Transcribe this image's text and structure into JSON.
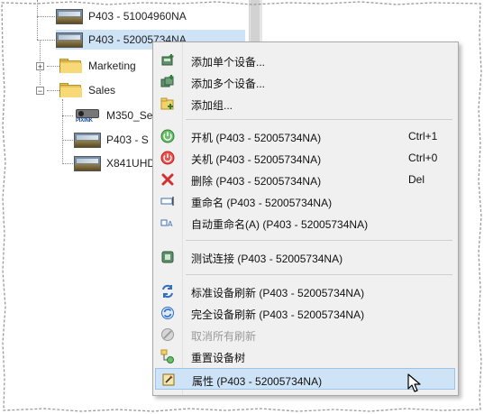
{
  "tree": {
    "items": [
      {
        "label": "P403 - 51004960NA",
        "type": "device"
      },
      {
        "label": "P403 - 52005734NA",
        "type": "device",
        "selected": true
      },
      {
        "label": "Marketing",
        "type": "folder",
        "expander": "+"
      },
      {
        "label": "Sales",
        "type": "folder",
        "expander": "−"
      },
      {
        "label": "M350_Se",
        "type": "projector"
      },
      {
        "label": "P403 - S",
        "type": "device"
      },
      {
        "label": "X841UHD",
        "type": "device"
      }
    ],
    "brand_text": "PIXINK"
  },
  "menu": {
    "items": [
      {
        "label": "添加单个设备...",
        "icon": "add-device-icon",
        "shortcut": ""
      },
      {
        "label": "添加多个设备...",
        "icon": "add-devices-icon",
        "shortcut": ""
      },
      {
        "label": "添加组...",
        "icon": "add-group-icon",
        "shortcut": ""
      },
      {
        "label": "开机  (P403 - 52005734NA)",
        "icon": "power-on-icon",
        "shortcut": "Ctrl+1"
      },
      {
        "label": "关机  (P403 - 52005734NA)",
        "icon": "power-off-icon",
        "shortcut": "Ctrl+0"
      },
      {
        "label": "删除  (P403 - 52005734NA)",
        "icon": "delete-icon",
        "shortcut": "Del"
      },
      {
        "label": "重命名  (P403 - 52005734NA)",
        "icon": "rename-icon",
        "shortcut": ""
      },
      {
        "label": "自动重命名(A)  (P403 - 52005734NA)",
        "icon": "auto-rename-icon",
        "shortcut": ""
      },
      {
        "label": "测试连接  (P403 - 52005734NA)",
        "icon": "test-connection-icon",
        "shortcut": ""
      },
      {
        "label": "标准设备刷新  (P403 - 52005734NA)",
        "icon": "standard-refresh-icon",
        "shortcut": ""
      },
      {
        "label": "完全设备刷新  (P403 - 52005734NA)",
        "icon": "full-refresh-icon",
        "shortcut": ""
      },
      {
        "label": "取消所有刷新",
        "icon": "cancel-refresh-icon",
        "shortcut": "",
        "disabled": true
      },
      {
        "label": "重置设备树",
        "icon": "reset-tree-icon",
        "shortcut": ""
      },
      {
        "label": "属性  (P403 - 52005734NA)",
        "icon": "properties-icon",
        "shortcut": "",
        "hover": true
      }
    ]
  },
  "colors": {
    "selection": "#cfe3f7",
    "menu_bg": "#f0f0f0",
    "power_on": "#4caf50",
    "power_off": "#e53935",
    "delete": "#d32f2f",
    "disabled_text": "#9a9a9a"
  }
}
